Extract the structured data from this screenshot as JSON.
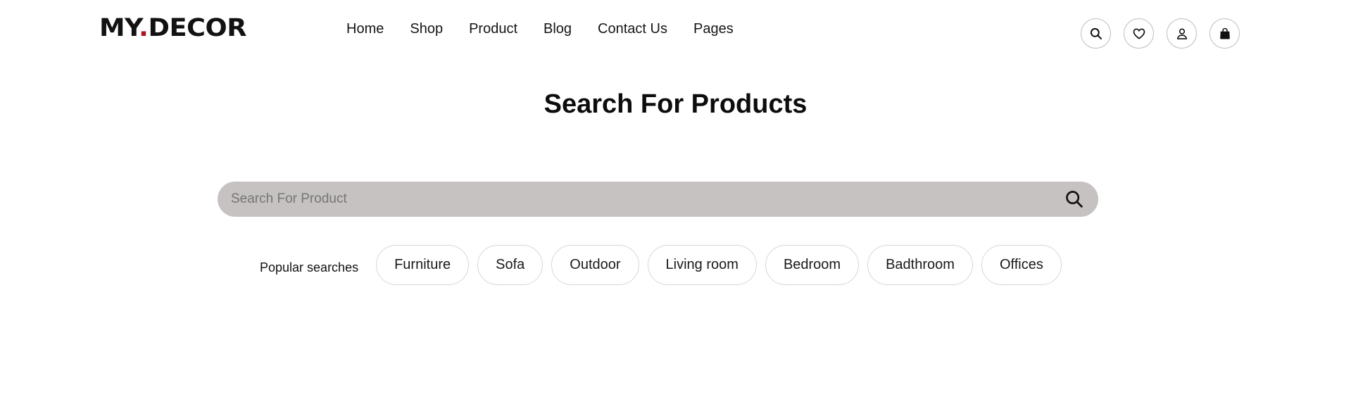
{
  "brand": {
    "logo_prefix": "MY",
    "logo_dot": ".",
    "logo_suffix": "DECOR",
    "dot_color": "#b0141d"
  },
  "nav": {
    "items": [
      {
        "label": "Home"
      },
      {
        "label": "Shop"
      },
      {
        "label": "Product"
      },
      {
        "label": "Blog"
      },
      {
        "label": "Contact Us"
      },
      {
        "label": "Pages"
      }
    ]
  },
  "header_icons": [
    "search-icon",
    "heart-icon",
    "user-icon",
    "shopping-bag-icon"
  ],
  "page": {
    "title": "Search For Products"
  },
  "search": {
    "placeholder": "Search For Product",
    "value": "",
    "bar_color": "#c5c2c1"
  },
  "popular": {
    "label": "Popular searches",
    "chips": [
      {
        "label": "Furniture"
      },
      {
        "label": "Sofa"
      },
      {
        "label": "Outdoor"
      },
      {
        "label": "Living room"
      },
      {
        "label": "Bedroom"
      },
      {
        "label": "Badthroom"
      },
      {
        "label": "Offices"
      }
    ]
  }
}
